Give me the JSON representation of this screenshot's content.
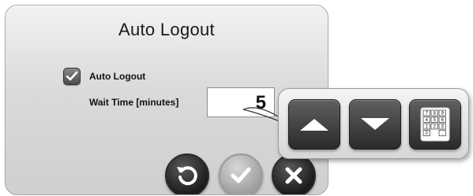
{
  "dialog": {
    "title": "Auto Logout",
    "auto_logout_checkbox": {
      "label": "Auto Logout",
      "checked": true
    },
    "wait_time": {
      "label": "Wait Time [minutes]",
      "value": "5"
    }
  },
  "buttons": {
    "reset_icon": "undo-icon",
    "ok_icon": "check-icon",
    "cancel_icon": "close-icon"
  },
  "spinner_popup": {
    "up_icon": "arrow-up-icon",
    "down_icon": "arrow-down-icon",
    "keypad_icon": "keypad-icon",
    "keypad_keys": [
      "7",
      "8",
      "9",
      "4",
      "5",
      "6",
      "1",
      "2",
      "3",
      "0",
      "."
    ]
  },
  "colors": {
    "dark_button": "#2a2a2a",
    "disabled_button": "#b5b5b5",
    "panel": "#d9d9d9"
  }
}
